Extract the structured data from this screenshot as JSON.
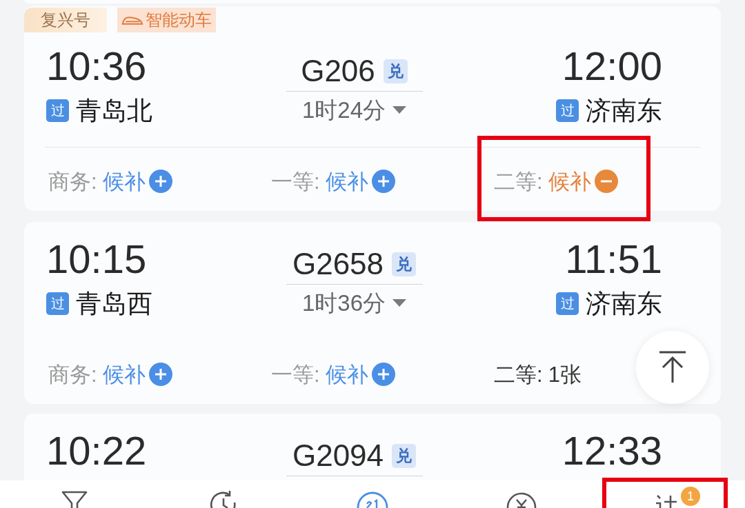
{
  "cards": [
    {
      "tags": [
        {
          "kind": "series",
          "text": "复兴号"
        },
        {
          "kind": "smart",
          "text": "智能动车"
        }
      ],
      "depart_time": "10:36",
      "depart_badge": "过",
      "depart_station": "青岛北",
      "train_no": "G206",
      "train_badge": "兑",
      "duration": "1时24分",
      "arrive_time": "12:00",
      "arrive_badge": "过",
      "arrive_station": "济南东",
      "separator": true,
      "seats": [
        {
          "label": "商务:",
          "value": "候补",
          "kind": "waitlist",
          "highlighted": false
        },
        {
          "label": "一等:",
          "value": "候补",
          "kind": "waitlist",
          "highlighted": false
        },
        {
          "label": "二等:",
          "value": "候补",
          "kind": "waitlist_added",
          "highlighted": true
        }
      ]
    },
    {
      "depart_time": "10:15",
      "depart_badge": "过",
      "depart_station": "青岛西",
      "train_no": "G2658",
      "train_badge": "兑",
      "duration": "1时36分",
      "arrive_time": "11:51",
      "arrive_badge": "过",
      "arrive_station": "济南东",
      "separator": false,
      "seats": [
        {
          "label": "商务:",
          "value": "候补",
          "kind": "waitlist",
          "highlighted": false
        },
        {
          "label": "一等:",
          "value": "候补",
          "kind": "waitlist",
          "highlighted": false
        },
        {
          "label": "二等:",
          "value": "1张",
          "kind": "available",
          "highlighted": false
        }
      ]
    },
    {
      "depart_time": "10:22",
      "train_no": "G2094",
      "train_badge": "兑",
      "arrive_time": "12:33"
    }
  ],
  "nav": [
    {
      "kind": "filter",
      "selected": false,
      "highlighted": false
    },
    {
      "kind": "history",
      "selected": false,
      "highlighted": false
    },
    {
      "kind": "calendar",
      "selected": true,
      "highlighted": false
    },
    {
      "kind": "fare",
      "selected": false,
      "highlighted": false
    },
    {
      "kind": "orders",
      "selected": false,
      "highlighted": true,
      "badge": "1"
    }
  ]
}
